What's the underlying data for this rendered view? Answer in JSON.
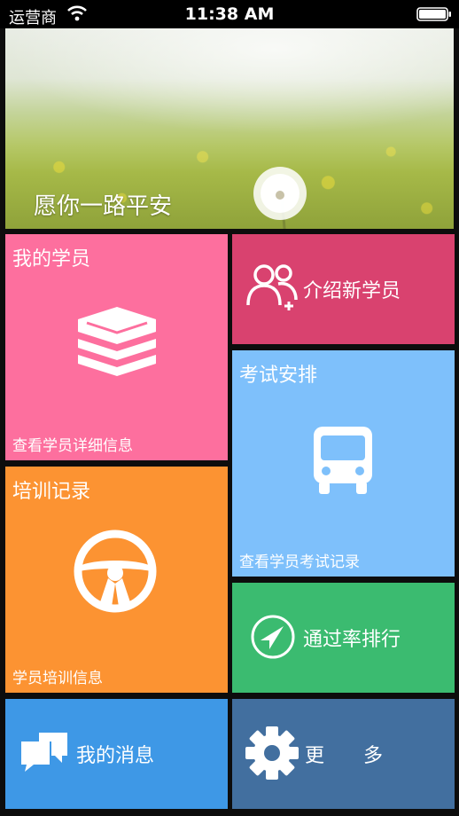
{
  "status_bar": {
    "carrier": "运营商",
    "time": "11:38 AM"
  },
  "banner": {
    "caption": "愿你一路平安",
    "page_count": 3,
    "active_page": 1
  },
  "tiles": {
    "students": {
      "title": "我的学员",
      "subtitle": "查看学员详细信息",
      "icon": "books-icon",
      "color": "#fd6f9e"
    },
    "introduce": {
      "label": "介绍新学员",
      "icon": "add-users-icon",
      "color": "#d9426f"
    },
    "exam": {
      "title": "考试安排",
      "subtitle": "查看学员考试记录",
      "icon": "bus-icon",
      "color": "#7ec0fb"
    },
    "training": {
      "title": "培训记录",
      "subtitle": "学员培训信息",
      "icon": "steering-wheel-icon",
      "color": "#fc9332"
    },
    "pass_rate": {
      "label": "通过率排行",
      "icon": "navigation-arrow-icon",
      "color": "#3bbb70"
    },
    "messages": {
      "label": "我的消息",
      "icon": "chat-bubbles-icon",
      "color": "#3e98e6"
    },
    "more": {
      "label": "更　　多",
      "icon": "gear-icon",
      "color": "#426f9f"
    }
  }
}
